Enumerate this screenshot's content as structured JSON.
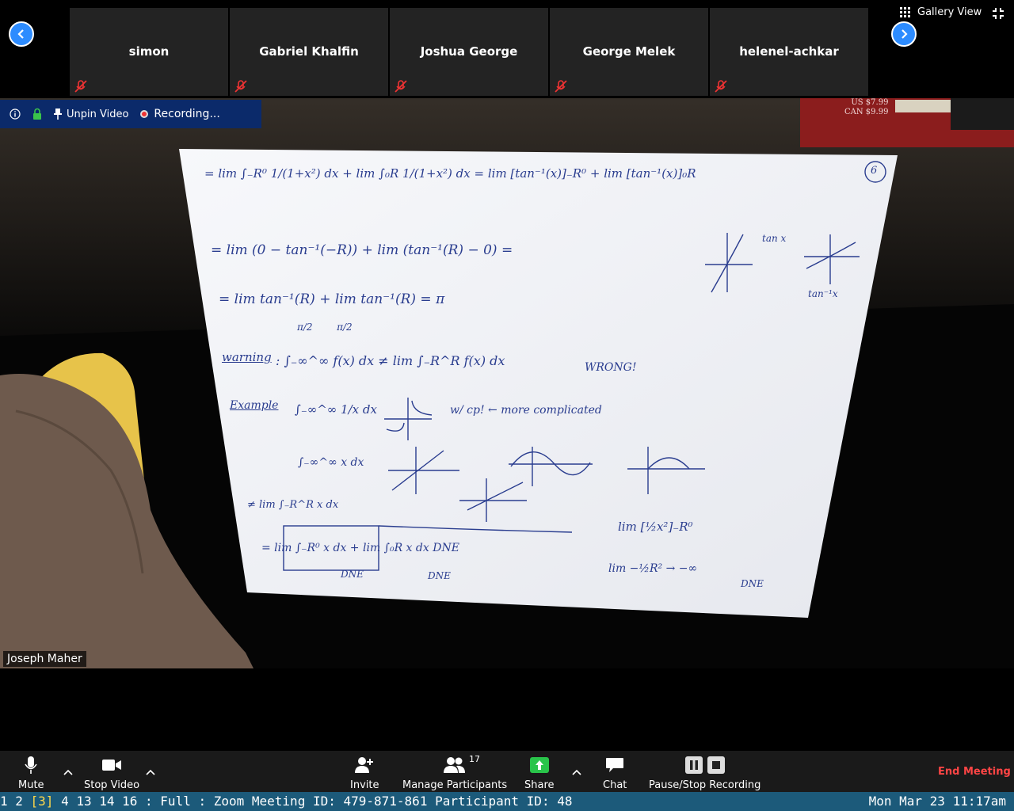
{
  "participants": [
    {
      "name": "simon"
    },
    {
      "name": "Gabriel Khalfin"
    },
    {
      "name": "Joshua George"
    },
    {
      "name": "George Melek"
    },
    {
      "name": "helenel-achkar"
    }
  ],
  "gallery_view_label": "Gallery View",
  "info_bar": {
    "unpin_label": "Unpin Video",
    "recording_label": "Recording..."
  },
  "active_speaker": "Joseph Maher",
  "whiteboard": {
    "line_1": "= lim ∫₋R⁰ 1/(1+x²) dx + lim ∫₀R 1/(1+x²) dx = lim [tan⁻¹(x)]₋R⁰ + lim [tan⁻¹(x)]₀R",
    "line_2": "= lim (0 − tan⁻¹(−R)) + lim (tan⁻¹(R) − 0) =",
    "line_3": "= lim tan⁻¹(R) + lim tan⁻¹(R) = π",
    "line_3b": "π/2        π/2",
    "warning_label": "warning",
    "warning_eq": ": ∫₋∞^∞ f(x) dx ≠ lim ∫₋R^R f(x) dx",
    "wrong": "WRONG!",
    "example_label": "Example",
    "example_eq": "∫₋∞^∞ 1/x dx",
    "example_note": "w/ cp!  ← more complicated",
    "int_x": "∫₋∞^∞ x dx",
    "neq_lim": "≠ lim ∫₋R^R x dx",
    "last_line": "= lim ∫₋R⁰ x dx + lim ∫₀R x dx  DNE",
    "dne_1": "DNE",
    "dne_2": "DNE",
    "side_1": "lim [½x²]₋R⁰",
    "side_2": "lim −½R² → −∞",
    "side_dne": "DNE",
    "page_num": "6",
    "tanx": "tan x",
    "taninv": "tan⁻¹x",
    "book_price": "US $7.99\nCAN $9.99"
  },
  "toolbar": {
    "mute": "Mute",
    "stop_video": "Stop Video",
    "invite": "Invite",
    "manage_participants": "Manage Participants",
    "participant_count": "17",
    "share": "Share",
    "chat": "Chat",
    "pause_stop_recording": "Pause/Stop Recording",
    "end_meeting": "End Meeting"
  },
  "status_bar": {
    "workspaces_left": "1 2 ",
    "current_workspace": "[3]",
    "workspaces_right": " 4 13 14 16 : Full : Zoom Meeting ID: 479-871-861 Participant ID: 48",
    "datetime": "Mon Mar 23 11:17am"
  },
  "colors": {
    "accent": "#2d8cff",
    "end_meeting": "#ff4545",
    "status_bar": "#1c5a7a",
    "ink": "#2a3d8f"
  }
}
